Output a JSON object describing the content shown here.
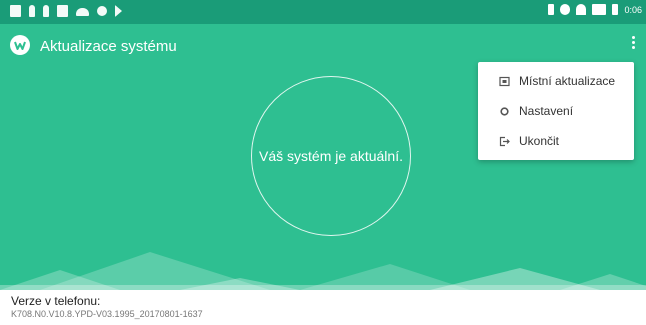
{
  "status_bar": {
    "time": "0:06",
    "left_icons": [
      "mail-icon",
      "notification-icon",
      "notification-icon",
      "image-icon",
      "cloud-icon",
      "tools-icon",
      "play-store-icon"
    ],
    "right_icons": [
      "bluetooth-icon",
      "do-not-disturb-icon",
      "wifi-icon",
      "signal-icon",
      "battery-icon"
    ]
  },
  "app_bar": {
    "title": "Aktualizace systému"
  },
  "hero": {
    "status_message": "Váš systém je aktuální."
  },
  "menu": {
    "items": [
      {
        "label": "Místní aktualizace",
        "icon": "local-update-icon"
      },
      {
        "label": "Nastavení",
        "icon": "settings-icon"
      },
      {
        "label": "Ukončit",
        "icon": "exit-icon"
      }
    ]
  },
  "footer": {
    "version_label": "Verze v telefonu:",
    "version_value": "K708.N0.V10.8.YPD-V03.1995_20170801-1637"
  },
  "colors": {
    "status_bar": "#1a9c78",
    "accent": "#2ebf91",
    "white": "#ffffff"
  }
}
